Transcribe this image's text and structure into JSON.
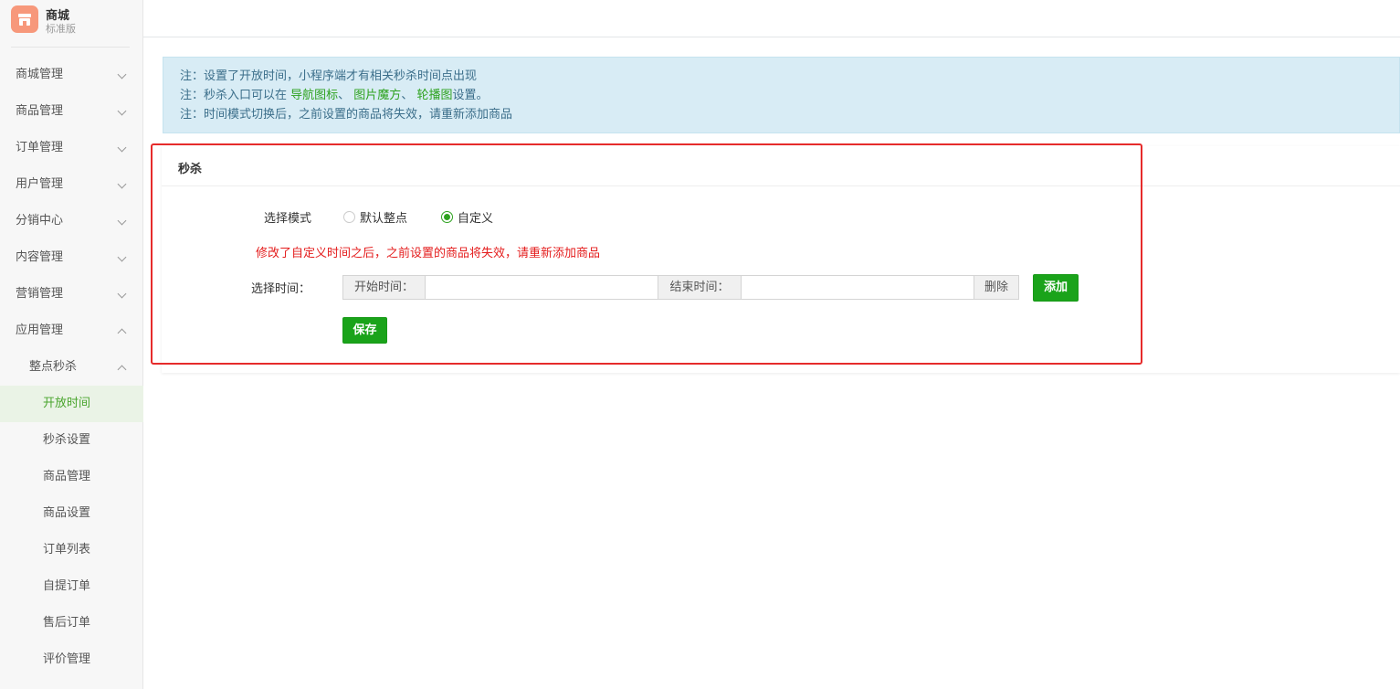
{
  "brand": {
    "title": "商城",
    "subtitle": "标准版"
  },
  "sidebar": {
    "items": [
      {
        "label": "商城管理"
      },
      {
        "label": "商品管理"
      },
      {
        "label": "订单管理"
      },
      {
        "label": "用户管理"
      },
      {
        "label": "分销中心"
      },
      {
        "label": "内容管理"
      },
      {
        "label": "营销管理"
      },
      {
        "label": "应用管理"
      }
    ],
    "submenu": {
      "label": "整点秒杀"
    },
    "leaves": [
      {
        "label": "开放时间",
        "active": true
      },
      {
        "label": "秒杀设置"
      },
      {
        "label": "商品管理"
      },
      {
        "label": "商品设置"
      },
      {
        "label": "订单列表"
      },
      {
        "label": "自提订单"
      },
      {
        "label": "售后订单"
      },
      {
        "label": "评价管理"
      }
    ]
  },
  "notice": {
    "line1": "注：设置了开放时间，小程序端才有相关秒杀时间点出现",
    "line2_prefix": "注：秒杀入口可以在 ",
    "link_nav": "导航图标",
    "sep1": "、 ",
    "link_cube": "图片魔方",
    "sep2": "、 ",
    "link_banner": "轮播图",
    "line2_suffix": "设置。",
    "line3": "注：时间模式切换后，之前设置的商品将失效，请重新添加商品"
  },
  "panel": {
    "title": "秒杀",
    "mode_label": "选择模式",
    "mode_options": [
      {
        "label": "默认整点",
        "checked": false
      },
      {
        "label": "自定义",
        "checked": true
      }
    ],
    "warning": "修改了自定义时间之后，之前设置的商品将失效，请重新添加商品",
    "time_label": "选择时间：",
    "start_addon": "开始时间：",
    "start_value": "",
    "end_addon": "结束时间：",
    "end_value": "",
    "delete_label": "删除",
    "add_label": "添加",
    "save_label": "保存"
  },
  "colors": {
    "accent": "#1aa31a",
    "warning": "#e41c1c",
    "notice_bg": "#d8ecf5",
    "highlight_border": "#e62b2b"
  }
}
